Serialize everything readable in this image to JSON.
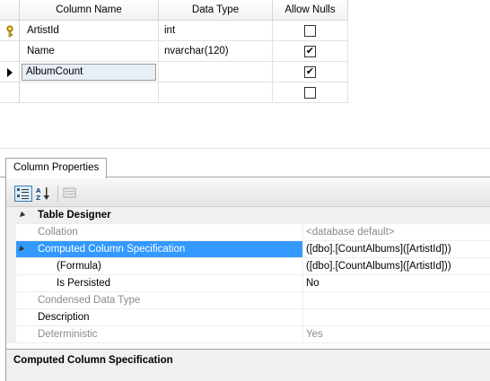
{
  "grid": {
    "headers": [
      "Column Name",
      "Data Type",
      "Allow Nulls"
    ],
    "rows": [
      {
        "name": "ArtistId",
        "type": "int",
        "allow_nulls": false,
        "primary_key": true,
        "current": false
      },
      {
        "name": "Name",
        "type": "nvarchar(120)",
        "allow_nulls": true,
        "primary_key": false,
        "current": false
      },
      {
        "name": "AlbumCount",
        "type": "",
        "allow_nulls": true,
        "primary_key": false,
        "current": true
      },
      {
        "name": "",
        "type": "",
        "allow_nulls": false,
        "primary_key": false,
        "current": false
      }
    ],
    "check_mark": "✔"
  },
  "properties": {
    "tab_label": "Column Properties",
    "rows": [
      {
        "name": "Table Designer",
        "value": "",
        "kind": "category"
      },
      {
        "name": "Collation",
        "value": "<database default>",
        "kind": "muted"
      },
      {
        "name": "Computed Column Specification",
        "value": "([dbo].[CountAlbums]([ArtistId]))",
        "kind": "selected"
      },
      {
        "name": "(Formula)",
        "value": "([dbo].[CountAlbums]([ArtistId]))",
        "kind": "sub"
      },
      {
        "name": "Is Persisted",
        "value": "No",
        "kind": "sub"
      },
      {
        "name": "Condensed Data Type",
        "value": "",
        "kind": "muted"
      },
      {
        "name": "Description",
        "value": "",
        "kind": "normal"
      },
      {
        "name": "Deterministic",
        "value": "Yes",
        "kind": "muted"
      }
    ],
    "description_title": "Computed Column Specification"
  },
  "colors": {
    "selection": "#3399ff",
    "muted_text": "#8a8a8a",
    "category_bg": "#f0f0f0"
  }
}
